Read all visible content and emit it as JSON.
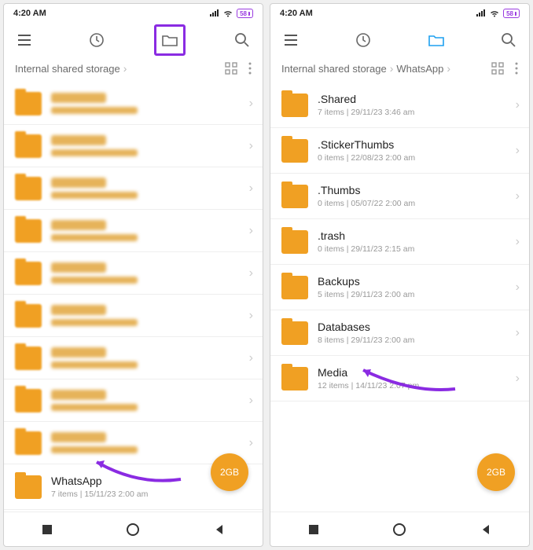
{
  "left": {
    "status": {
      "time": "4:20 AM",
      "battery": "58"
    },
    "breadcrumb": [
      "Internal shared storage"
    ],
    "blurred_rows": 9,
    "visible_row": {
      "title": "WhatsApp",
      "meta": "7 items  |  15/11/23 2:00 am"
    },
    "fab": "2GB"
  },
  "right": {
    "status": {
      "time": "4:20 AM",
      "battery": "58"
    },
    "breadcrumb": [
      "Internal shared storage",
      "WhatsApp"
    ],
    "rows": [
      {
        "title": ".Shared",
        "meta": "7 items  |  29/11/23 3:46 am"
      },
      {
        "title": ".StickerThumbs",
        "meta": "0 items  |  22/08/23 2:00 am"
      },
      {
        "title": ".Thumbs",
        "meta": "0 items  |  05/07/22 2:00 am"
      },
      {
        "title": ".trash",
        "meta": "0 items  |  29/11/23 2:15 am"
      },
      {
        "title": "Backups",
        "meta": "5 items  |  29/11/23 2:00 am"
      },
      {
        "title": "Databases",
        "meta": "8 items  |  29/11/23 2:00 am"
      },
      {
        "title": "Media",
        "meta": "12 items  |  14/11/23 2:07 pm"
      }
    ],
    "fab": "2GB"
  }
}
